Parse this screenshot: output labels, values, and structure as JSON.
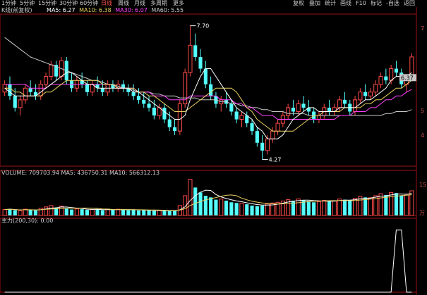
{
  "toolbar": {
    "periods": [
      "1分钟",
      "5分钟",
      "15分钟",
      "30分钟",
      "60分钟",
      "日线",
      "周线",
      "月线",
      "多周期",
      "更多"
    ],
    "right_tools": [
      "复权",
      "叠加",
      "统计",
      "画线",
      "F10",
      "标记",
      "-自选",
      "返回"
    ]
  },
  "legend_main": {
    "name": "K线(前复权)",
    "ma5": "MA5: 6.27",
    "ma10": "MA10: 6.38",
    "ma30": "MA30: 6.07",
    "ma60": "MA60: 5.55"
  },
  "legend_volume": {
    "text": "VOLUME: 709703.94  MA5: 436750.31  MA10: 566312.13"
  },
  "legend_indicator": {
    "text": "主力(200,30): 0.00"
  },
  "price_labels": {
    "high": "7.70",
    "low": "4.27",
    "last": "6.37"
  },
  "axis_labels": {
    "top": "7",
    "mid": "5",
    "bottom": "4",
    "vol_top": "15",
    "vol_bottom": "万"
  },
  "colors": {
    "up": "#ff4a4a",
    "down": "#54ffff",
    "ma5": "#ffffff",
    "ma10": "#e8d060",
    "ma30": "#ff40ff",
    "ma60": "#c8c8c8",
    "frame": "#a01010",
    "background": "#000000"
  },
  "chart_data": [
    {
      "type": "candlestick",
      "title": "K线(前复权)",
      "price_high_mark": 7.7,
      "price_low_mark": 4.27,
      "last_price": 6.37,
      "candles": [
        [
          6.0,
          6.3,
          5.9,
          6.2
        ],
        [
          6.2,
          6.4,
          5.8,
          5.9
        ],
        [
          5.9,
          6.1,
          5.5,
          5.6
        ],
        [
          5.6,
          5.9,
          5.4,
          5.8
        ],
        [
          5.8,
          6.2,
          5.7,
          6.1
        ],
        [
          6.1,
          6.3,
          5.9,
          6.0
        ],
        [
          6.0,
          6.2,
          5.8,
          5.9
        ],
        [
          5.9,
          6.3,
          5.8,
          6.2
        ],
        [
          6.2,
          6.5,
          6.1,
          6.4
        ],
        [
          6.4,
          6.8,
          6.3,
          6.7
        ],
        [
          6.7,
          6.8,
          6.3,
          6.4
        ],
        [
          6.4,
          6.9,
          6.3,
          6.8
        ],
        [
          6.8,
          6.9,
          6.2,
          6.3
        ],
        [
          6.3,
          6.5,
          6.0,
          6.1
        ],
        [
          6.1,
          6.4,
          6.0,
          6.3
        ],
        [
          6.3,
          6.5,
          6.1,
          6.2
        ],
        [
          6.2,
          6.3,
          5.9,
          6.0
        ],
        [
          6.0,
          6.3,
          5.9,
          6.2
        ],
        [
          6.2,
          6.4,
          6.0,
          6.1
        ],
        [
          6.1,
          6.3,
          5.9,
          6.0
        ],
        [
          6.0,
          6.3,
          5.9,
          6.2
        ],
        [
          6.2,
          6.3,
          6.0,
          6.1
        ],
        [
          6.1,
          6.3,
          6.0,
          6.2
        ],
        [
          6.2,
          6.3,
          6.0,
          6.1
        ],
        [
          6.1,
          6.2,
          5.9,
          6.0
        ],
        [
          6.0,
          6.2,
          5.8,
          5.9
        ],
        [
          5.9,
          6.1,
          5.7,
          5.8
        ],
        [
          5.8,
          6.0,
          5.6,
          5.7
        ],
        [
          5.7,
          5.9,
          5.5,
          5.6
        ],
        [
          5.6,
          5.8,
          5.3,
          5.4
        ],
        [
          5.4,
          5.7,
          5.3,
          5.6
        ],
        [
          5.6,
          5.7,
          5.2,
          5.3
        ],
        [
          5.3,
          5.5,
          5.0,
          5.1
        ],
        [
          5.1,
          5.3,
          4.9,
          5.0
        ],
        [
          5.0,
          5.8,
          4.9,
          5.7
        ],
        [
          5.7,
          6.6,
          5.6,
          6.5
        ],
        [
          6.5,
          7.7,
          6.4,
          7.2
        ],
        [
          7.2,
          7.5,
          6.8,
          6.9
        ],
        [
          6.9,
          7.1,
          6.5,
          6.6
        ],
        [
          6.6,
          6.8,
          6.1,
          6.2
        ],
        [
          6.2,
          6.4,
          5.8,
          5.9
        ],
        [
          5.9,
          6.0,
          5.6,
          5.7
        ],
        [
          5.7,
          5.9,
          5.5,
          5.8
        ],
        [
          5.8,
          6.0,
          5.6,
          5.7
        ],
        [
          5.7,
          5.8,
          5.4,
          5.5
        ],
        [
          5.5,
          5.6,
          5.2,
          5.3
        ],
        [
          5.3,
          5.5,
          5.1,
          5.4
        ],
        [
          5.4,
          5.5,
          5.1,
          5.2
        ],
        [
          5.2,
          5.3,
          4.9,
          5.0
        ],
        [
          5.0,
          5.1,
          4.6,
          4.7
        ],
        [
          4.7,
          4.9,
          4.27,
          4.5
        ],
        [
          4.5,
          4.9,
          4.4,
          4.8
        ],
        [
          4.8,
          5.1,
          4.7,
          5.0
        ],
        [
          5.0,
          5.3,
          4.9,
          5.2
        ],
        [
          5.2,
          5.5,
          5.1,
          5.4
        ],
        [
          5.4,
          5.7,
          5.3,
          5.6
        ],
        [
          5.6,
          5.8,
          5.4,
          5.5
        ],
        [
          5.5,
          5.8,
          5.4,
          5.7
        ],
        [
          5.7,
          5.9,
          5.5,
          5.6
        ],
        [
          5.6,
          5.8,
          5.4,
          5.5
        ],
        [
          5.5,
          5.6,
          5.2,
          5.3
        ],
        [
          5.3,
          5.5,
          5.2,
          5.4
        ],
        [
          5.4,
          5.7,
          5.3,
          5.6
        ],
        [
          5.6,
          5.8,
          5.4,
          5.5
        ],
        [
          5.5,
          5.7,
          5.4,
          5.6
        ],
        [
          5.6,
          5.9,
          5.5,
          5.8
        ],
        [
          5.8,
          6.0,
          5.6,
          5.7
        ],
        [
          5.7,
          5.8,
          5.4,
          5.5
        ],
        [
          5.5,
          5.9,
          5.4,
          5.8
        ],
        [
          5.8,
          6.1,
          5.7,
          6.0
        ],
        [
          6.0,
          6.2,
          5.8,
          5.9
        ],
        [
          5.9,
          6.1,
          5.8,
          6.0
        ],
        [
          6.0,
          6.3,
          5.9,
          6.2
        ],
        [
          6.2,
          6.5,
          6.1,
          6.4
        ],
        [
          6.4,
          6.6,
          6.2,
          6.3
        ],
        [
          6.3,
          6.7,
          6.2,
          6.6
        ],
        [
          6.6,
          6.8,
          6.4,
          6.5
        ],
        [
          6.5,
          6.6,
          6.1,
          6.2
        ],
        [
          6.2,
          6.4,
          6.0,
          6.37
        ],
        [
          6.37,
          7.0,
          6.3,
          6.9
        ]
      ],
      "ma5": [
        6.1,
        6.0,
        5.9,
        5.9,
        5.9,
        5.9,
        5.9,
        6.0,
        6.1,
        6.2,
        6.3,
        6.4,
        6.5,
        6.5,
        6.4,
        6.3,
        6.2,
        6.2,
        6.1,
        6.1,
        6.1,
        6.1,
        6.1,
        6.1,
        6.1,
        6.0,
        6.0,
        5.9,
        5.8,
        5.7,
        5.6,
        5.5,
        5.4,
        5.3,
        5.3,
        5.4,
        5.8,
        6.1,
        6.4,
        6.6,
        6.6,
        6.4,
        6.2,
        6.0,
        5.8,
        5.6,
        5.5,
        5.4,
        5.3,
        5.1,
        5.0,
        4.8,
        4.8,
        4.8,
        4.9,
        5.1,
        5.3,
        5.4,
        5.5,
        5.6,
        5.6,
        5.5,
        5.5,
        5.5,
        5.5,
        5.6,
        5.6,
        5.6,
        5.6,
        5.7,
        5.8,
        5.8,
        5.9,
        6.0,
        6.1,
        6.3,
        6.4,
        6.4,
        6.4,
        6.5
      ],
      "ma10": [
        6.1,
        6.1,
        6.0,
        6.0,
        5.9,
        5.9,
        5.9,
        5.9,
        6.0,
        6.0,
        6.1,
        6.2,
        6.3,
        6.3,
        6.3,
        6.3,
        6.3,
        6.3,
        6.3,
        6.2,
        6.2,
        6.2,
        6.1,
        6.1,
        6.1,
        6.1,
        6.0,
        6.0,
        5.9,
        5.9,
        5.8,
        5.7,
        5.6,
        5.5,
        5.5,
        5.5,
        5.6,
        5.7,
        5.8,
        5.9,
        6.0,
        6.1,
        6.1,
        6.1,
        6.1,
        6.0,
        5.8,
        5.6,
        5.5,
        5.3,
        5.2,
        5.1,
        5.0,
        5.0,
        5.0,
        5.0,
        5.0,
        5.1,
        5.2,
        5.3,
        5.4,
        5.4,
        5.5,
        5.5,
        5.5,
        5.5,
        5.6,
        5.6,
        5.6,
        5.6,
        5.7,
        5.7,
        5.8,
        5.8,
        5.9,
        6.0,
        6.1,
        6.1,
        6.2,
        6.3
      ],
      "ma30": [
        6.2,
        6.2,
        6.2,
        6.2,
        6.2,
        6.1,
        6.1,
        6.1,
        6.1,
        6.2,
        6.2,
        6.2,
        6.2,
        6.2,
        6.2,
        6.2,
        6.2,
        6.2,
        6.2,
        6.2,
        6.2,
        6.2,
        6.1,
        6.1,
        6.1,
        6.1,
        6.0,
        6.0,
        6.0,
        5.9,
        5.9,
        5.9,
        5.8,
        5.8,
        5.8,
        5.8,
        5.9,
        5.9,
        5.9,
        5.9,
        5.9,
        5.9,
        5.8,
        5.8,
        5.8,
        5.7,
        5.7,
        5.6,
        5.6,
        5.5,
        5.4,
        5.4,
        5.4,
        5.3,
        5.3,
        5.3,
        5.3,
        5.3,
        5.3,
        5.3,
        5.3,
        5.3,
        5.3,
        5.3,
        5.3,
        5.4,
        5.4,
        5.4,
        5.5,
        5.5,
        5.5,
        5.6,
        5.6,
        5.7,
        5.8,
        5.8,
        5.9,
        5.9,
        6.0,
        6.07
      ],
      "ma60": [
        7.4,
        7.3,
        7.2,
        7.1,
        7.0,
        6.9,
        6.85,
        6.8,
        6.75,
        6.7,
        6.65,
        6.6,
        6.55,
        6.5,
        6.45,
        6.4,
        6.35,
        6.3,
        6.3,
        6.25,
        6.2,
        6.2,
        6.15,
        6.1,
        6.1,
        6.05,
        6.0,
        6.0,
        6.0,
        5.95,
        5.95,
        5.9,
        5.9,
        5.9,
        5.85,
        5.85,
        5.85,
        5.85,
        5.8,
        5.8,
        5.8,
        5.8,
        5.75,
        5.75,
        5.7,
        5.7,
        5.65,
        5.65,
        5.6,
        5.6,
        5.55,
        5.55,
        5.5,
        5.5,
        5.5,
        5.45,
        5.45,
        5.45,
        5.45,
        5.4,
        5.4,
        5.4,
        5.4,
        5.4,
        5.4,
        5.4,
        5.4,
        5.4,
        5.4,
        5.4,
        5.4,
        5.4,
        5.4,
        5.4,
        5.45,
        5.45,
        5.5,
        5.5,
        5.5,
        5.55
      ],
      "ylim": [
        4.1,
        8.0
      ]
    },
    {
      "type": "bar",
      "title": "VOLUME",
      "values": [
        18,
        20,
        16,
        14,
        19,
        17,
        15,
        22,
        26,
        30,
        24,
        28,
        21,
        18,
        20,
        19,
        17,
        18,
        19,
        16,
        18,
        17,
        19,
        18,
        16,
        17,
        15,
        16,
        15,
        14,
        15,
        14,
        13,
        14,
        30,
        60,
        110,
        85,
        70,
        60,
        55,
        48,
        50,
        45,
        40,
        38,
        36,
        34,
        30,
        28,
        30,
        35,
        38,
        40,
        44,
        48,
        45,
        50,
        47,
        44,
        40,
        42,
        46,
        44,
        45,
        50,
        48,
        45,
        52,
        58,
        55,
        54,
        60,
        66,
        62,
        70,
        68,
        60,
        62,
        75
      ],
      "ylim": [
        0,
        120
      ]
    },
    {
      "type": "line",
      "title": "主力",
      "values": [
        0,
        0,
        0,
        0,
        0,
        0,
        0,
        0,
        0,
        0,
        0,
        0,
        0,
        0,
        0,
        0,
        0,
        0,
        0,
        0,
        0,
        0,
        0,
        0,
        0,
        0,
        0,
        0,
        0,
        0,
        0,
        0,
        0,
        0,
        0,
        0,
        0,
        0,
        0,
        0,
        0,
        0,
        0,
        0,
        0,
        0,
        0,
        0,
        0,
        0,
        0,
        0,
        0,
        0,
        0,
        0,
        0,
        0,
        0,
        0,
        0,
        0,
        0,
        0,
        0,
        0,
        0,
        0,
        0,
        0,
        0,
        0,
        0,
        0,
        0,
        0,
        100,
        100,
        0,
        0
      ],
      "ylim": [
        0,
        110
      ]
    }
  ]
}
